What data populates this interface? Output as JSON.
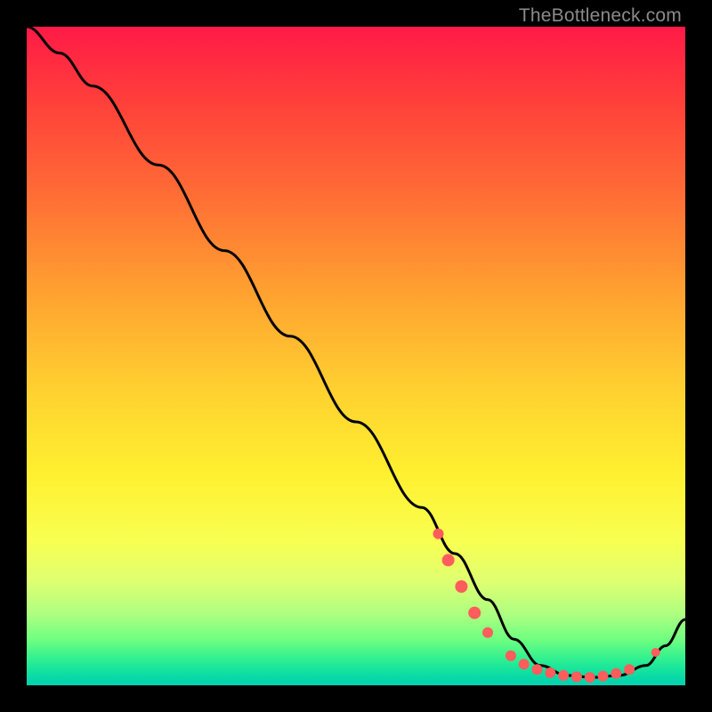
{
  "watermark": "TheBottleneck.com",
  "chart_data": {
    "type": "line",
    "title": "",
    "xlabel": "",
    "ylabel": "",
    "xlim": [
      0,
      100
    ],
    "ylim": [
      0,
      100
    ],
    "grid": false,
    "series": [
      {
        "name": "bottleneck-curve",
        "color": "#000000",
        "x": [
          0,
          5,
          10,
          20,
          30,
          40,
          50,
          60,
          65,
          70,
          74,
          78,
          82,
          86,
          90,
          94,
          97,
          100
        ],
        "values": [
          100,
          96,
          91,
          79,
          66,
          53,
          40,
          27,
          20,
          13,
          7,
          3,
          1.5,
          1.2,
          1.5,
          3,
          6,
          10
        ]
      }
    ],
    "markers": [
      {
        "x": 62.5,
        "y": 23,
        "r": 6
      },
      {
        "x": 64,
        "y": 19,
        "r": 7
      },
      {
        "x": 66,
        "y": 15,
        "r": 7
      },
      {
        "x": 68,
        "y": 11,
        "r": 7
      },
      {
        "x": 70,
        "y": 8,
        "r": 6
      },
      {
        "x": 73.5,
        "y": 4.5,
        "r": 6
      },
      {
        "x": 75.5,
        "y": 3.2,
        "r": 6
      },
      {
        "x": 77.5,
        "y": 2.4,
        "r": 6
      },
      {
        "x": 79.5,
        "y": 1.9,
        "r": 6
      },
      {
        "x": 81.5,
        "y": 1.5,
        "r": 6
      },
      {
        "x": 83.5,
        "y": 1.3,
        "r": 6
      },
      {
        "x": 85.5,
        "y": 1.2,
        "r": 6
      },
      {
        "x": 87.5,
        "y": 1.4,
        "r": 6
      },
      {
        "x": 89.5,
        "y": 1.8,
        "r": 6
      },
      {
        "x": 91.5,
        "y": 2.4,
        "r": 6
      },
      {
        "x": 95.5,
        "y": 5.0,
        "r": 5
      }
    ],
    "marker_color": "#ff5c5c"
  }
}
